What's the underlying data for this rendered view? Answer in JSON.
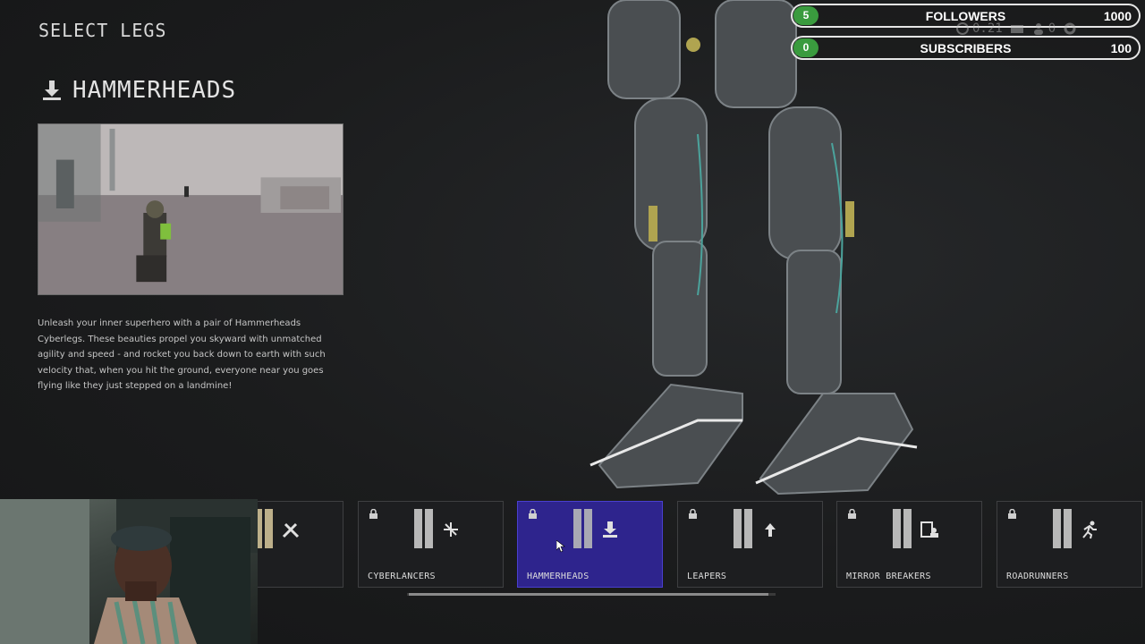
{
  "screen": {
    "title": "SELECT LEGS"
  },
  "selected_item": {
    "title": "HAMMERHEADS",
    "description": "Unleash your inner superhero with a pair of Hammerheads Cyberlegs. These beauties propel you skyward with unmatched agility and speed - and rocket you back down to earth with such velocity that, when you hit the ground, everyone near you goes flying like they just stepped on a landmine!"
  },
  "overlay": {
    "followers": {
      "count": "5",
      "label": "FOLLOWERS",
      "goal": "1000"
    },
    "subscribers": {
      "count": "0",
      "label": "SUBSCRIBERS",
      "goal": "100"
    }
  },
  "hud": {
    "currency": "0.21",
    "party_count": "0"
  },
  "carousel": {
    "items": [
      {
        "name": "",
        "locked": false,
        "icon": "tools-icon",
        "selected": false
      },
      {
        "name": "CYBERLANCERS",
        "locked": true,
        "icon": "spark-icon",
        "selected": false
      },
      {
        "name": "HAMMERHEADS",
        "locked": true,
        "icon": "download-icon",
        "selected": true
      },
      {
        "name": "LEAPERS",
        "locked": true,
        "icon": "arrow-up-icon",
        "selected": false
      },
      {
        "name": "MIRROR BREAKERS",
        "locked": true,
        "icon": "person-card-icon",
        "selected": false
      },
      {
        "name": "ROADRUNNERS",
        "locked": true,
        "icon": "runner-icon",
        "selected": false
      }
    ],
    "scroll_position": 0.5
  },
  "colors": {
    "background": "#1c1d1e",
    "selected_card": "#2e248d",
    "overlay_count": "#3a9b3e"
  }
}
